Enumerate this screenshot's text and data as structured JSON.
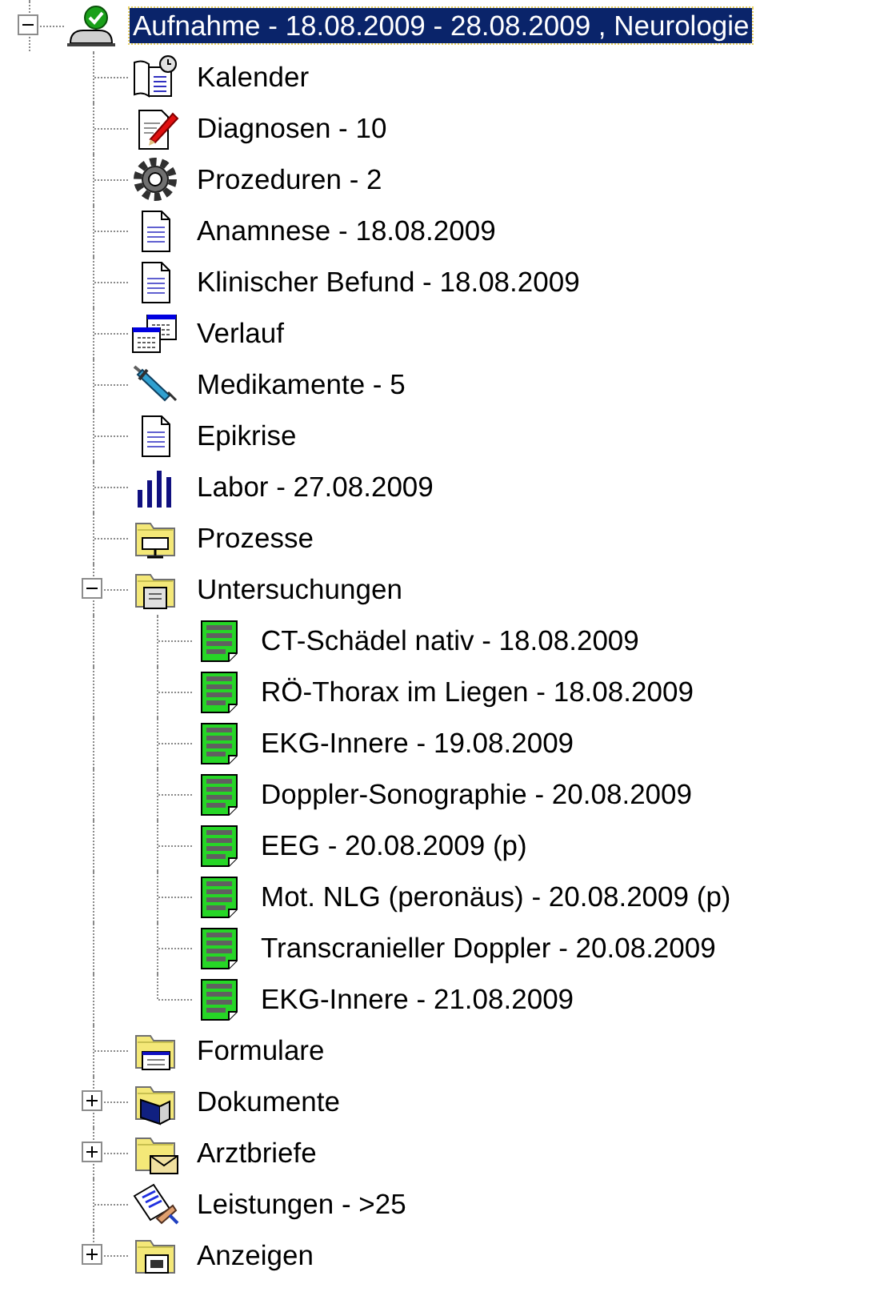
{
  "tree": {
    "items": [
      {
        "label": "Aufnahme - 18.08.2009 - 28.08.2009 , Neurologie",
        "kind": "person-check",
        "selected": true,
        "expanded": true,
        "children": [
          {
            "label": "Kalender",
            "kind": "calendar",
            "selected": false
          },
          {
            "label": "Diagnosen - 10",
            "kind": "doc-pen",
            "selected": false
          },
          {
            "label": "Prozeduren - 2",
            "kind": "gear",
            "selected": false
          },
          {
            "label": "Anamnese - 18.08.2009",
            "kind": "document",
            "selected": false
          },
          {
            "label": "Klinischer Befund - 18.08.2009",
            "kind": "document",
            "selected": false
          },
          {
            "label": "Verlauf",
            "kind": "windows",
            "selected": false
          },
          {
            "label": "Medikamente - 5",
            "kind": "syringe",
            "selected": false
          },
          {
            "label": "Epikrise",
            "kind": "document",
            "selected": false
          },
          {
            "label": "Labor - 27.08.2009",
            "kind": "bars",
            "selected": false
          },
          {
            "label": "Prozesse",
            "kind": "folder-monitor",
            "selected": false
          },
          {
            "label": "Untersuchungen",
            "kind": "folder-doc",
            "selected": false,
            "expanded": true,
            "children": [
              {
                "label": "CT-Schädel nativ - 18.08.2009",
                "kind": "report",
                "selected": false
              },
              {
                "label": "RÖ-Thorax im Liegen - 18.08.2009",
                "kind": "report",
                "selected": false
              },
              {
                "label": "EKG-Innere - 19.08.2009",
                "kind": "report",
                "selected": false
              },
              {
                "label": "Doppler-Sonographie - 20.08.2009",
                "kind": "report",
                "selected": false
              },
              {
                "label": "EEG - 20.08.2009 (p)",
                "kind": "report",
                "selected": false
              },
              {
                "label": "Mot. NLG (peronäus) - 20.08.2009 (p)",
                "kind": "report",
                "selected": false
              },
              {
                "label": "Transcranieller Doppler - 20.08.2009",
                "kind": "report",
                "selected": false
              },
              {
                "label": "EKG-Innere - 21.08.2009",
                "kind": "report",
                "selected": false
              }
            ]
          },
          {
            "label": "Formulare",
            "kind": "folder-form",
            "selected": false
          },
          {
            "label": "Dokumente",
            "kind": "folder-book",
            "selected": false,
            "expanded": false
          },
          {
            "label": "Arztbriefe",
            "kind": "folder-letter",
            "selected": false,
            "expanded": false
          },
          {
            "label": "Leistungen - >25",
            "kind": "pen-list",
            "selected": false
          },
          {
            "label": "Anzeigen",
            "kind": "folder-display",
            "selected": false,
            "expanded": false
          }
        ]
      }
    ]
  }
}
